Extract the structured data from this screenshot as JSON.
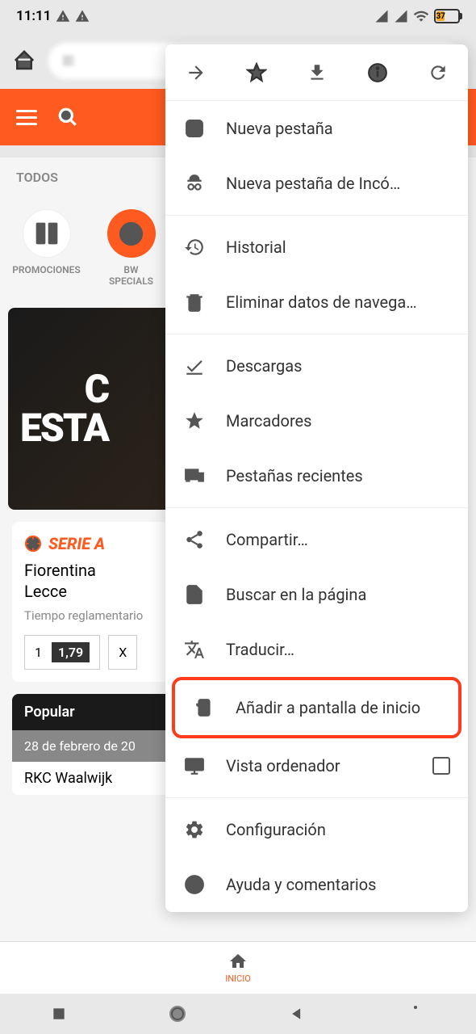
{
  "status": {
    "time": "11:11",
    "battery": "37"
  },
  "header": {
    "tab": "TODOS"
  },
  "icons": {
    "promociones": "PROMOCIONES",
    "specials": "BW SPECIALS"
  },
  "banner": {
    "line1": "C",
    "line2": "ESTA"
  },
  "match": {
    "league": "SERIE A",
    "team1": "Fiorentina",
    "team2": "Lecce",
    "time": "Tiempo reglamentario",
    "odd1_label": "1",
    "odd1_val": "1,79",
    "odd2_label": "X"
  },
  "popular": {
    "title": "Popular",
    "date": "28 de febrero de 20",
    "match": "RKC Waalwijk"
  },
  "nav": {
    "inicio": "INICIO"
  },
  "menu": {
    "nueva_pestana": "Nueva pestaña",
    "incognito": "Nueva pestaña de Incó…",
    "historial": "Historial",
    "eliminar": "Eliminar datos de navega…",
    "descargas": "Descargas",
    "marcadores": "Marcadores",
    "recientes": "Pestañas recientes",
    "compartir": "Compartir…",
    "buscar": "Buscar en la página",
    "traducir": "Traducir…",
    "anadir": "Añadir a pantalla de inicio",
    "vista": "Vista ordenador",
    "config": "Configuración",
    "ayuda": "Ayuda y comentarios"
  }
}
